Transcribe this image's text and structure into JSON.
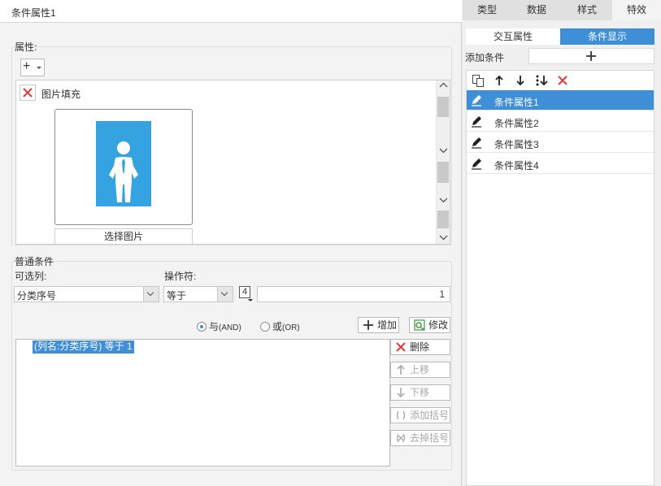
{
  "left": {
    "title": "条件属性1",
    "attr_section_label": "属性:",
    "add_button_label": "+",
    "attr_item_name": "图片填充",
    "choose_image_label": "选择图片",
    "cond_section_label": "普通条件",
    "column_label": "可选列:",
    "column_value": "分类序号",
    "operator_label": "操作符:",
    "operator_value": "等于",
    "type_icon_text": "4",
    "value": "1",
    "radio_and_label": "与",
    "radio_and_sub": "(AND)",
    "radio_or_label": "或",
    "radio_or_sub": "(OR)",
    "add_label": "增加",
    "edit_label": "修改",
    "condition_text": "(列名:分类序号) 等于 1",
    "delete_label": "删除",
    "move_up_label": "上移",
    "move_down_label": "下移",
    "add_bracket_label": "添加括号",
    "remove_bracket_label": "去掉括号"
  },
  "right": {
    "tabs": [
      "类型",
      "数据",
      "样式",
      "特效"
    ],
    "subtabs": [
      "交互属性",
      "条件显示"
    ],
    "add_condition_label": "添加条件",
    "conditions": [
      "条件属性1",
      "条件属性2",
      "条件属性3",
      "条件属性4"
    ]
  },
  "colors": {
    "accent": "#3e8ed8",
    "image_bg": "#35a3e0",
    "delete_red": "#e03b3b"
  }
}
